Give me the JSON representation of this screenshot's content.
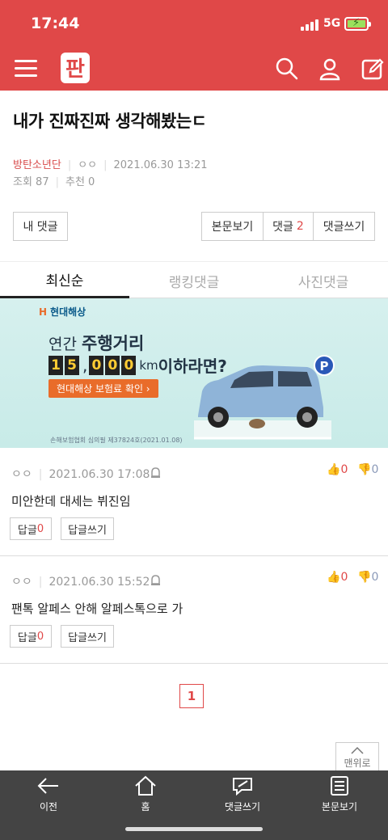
{
  "status": {
    "time": "17:44",
    "network": "5G",
    "battery_charging": true
  },
  "header": {
    "logo_text": "판",
    "accent": "#e04848"
  },
  "post": {
    "title": "내가 진짜진짜 생각해봤는ㄷ",
    "author": "방탄소년단",
    "nickname": "ㅇㅇ",
    "datetime": "2021.06.30 13:21",
    "views_label": "조회 87",
    "recommend_label": "추천 0"
  },
  "actions": {
    "my_comments": "내 댓글",
    "view_body": "본문보기",
    "comments_label": "댓글",
    "comments_count": "2",
    "write_comment": "댓글쓰기"
  },
  "tabs": [
    {
      "label": "최신순",
      "active": true
    },
    {
      "label": "랭킹댓글",
      "active": false
    },
    {
      "label": "사진댓글",
      "active": false
    }
  ],
  "ad": {
    "brand": "현대해상",
    "line1_prefix": "연간 ",
    "line1_bold": "주행거리",
    "digits": [
      "1",
      "5",
      ",",
      "0",
      "0",
      "0"
    ],
    "unit": "km",
    "line2_suffix": " 이하라면?",
    "cta": "현대해상 보험료 확인 ›",
    "fine_print": "손해보험협회 심의필 제37824호(2021.01.08)"
  },
  "comments": [
    {
      "author": "ㅇㅇ",
      "datetime": "2021.06.30 17:08",
      "text": "미안한데 대세는 뷔진임",
      "likes": "0",
      "dislikes": "0",
      "reply_label": "답글",
      "reply_count": "0",
      "write_reply": "답글쓰기"
    },
    {
      "author": "ㅇㅇ",
      "datetime": "2021.06.30 15:52",
      "text": "팬톡 알페스 안해 알페스톡으로 가",
      "likes": "0",
      "dislikes": "0",
      "reply_label": "답글",
      "reply_count": "0",
      "write_reply": "답글쓰기"
    }
  ],
  "pagination": {
    "current": "1"
  },
  "to_top": "맨위로",
  "bottom_nav": [
    {
      "label": "이전",
      "icon": "back-arrow-icon"
    },
    {
      "label": "홈",
      "icon": "home-icon"
    },
    {
      "label": "댓글쓰기",
      "icon": "write-comment-icon"
    },
    {
      "label": "본문보기",
      "icon": "document-icon"
    }
  ]
}
